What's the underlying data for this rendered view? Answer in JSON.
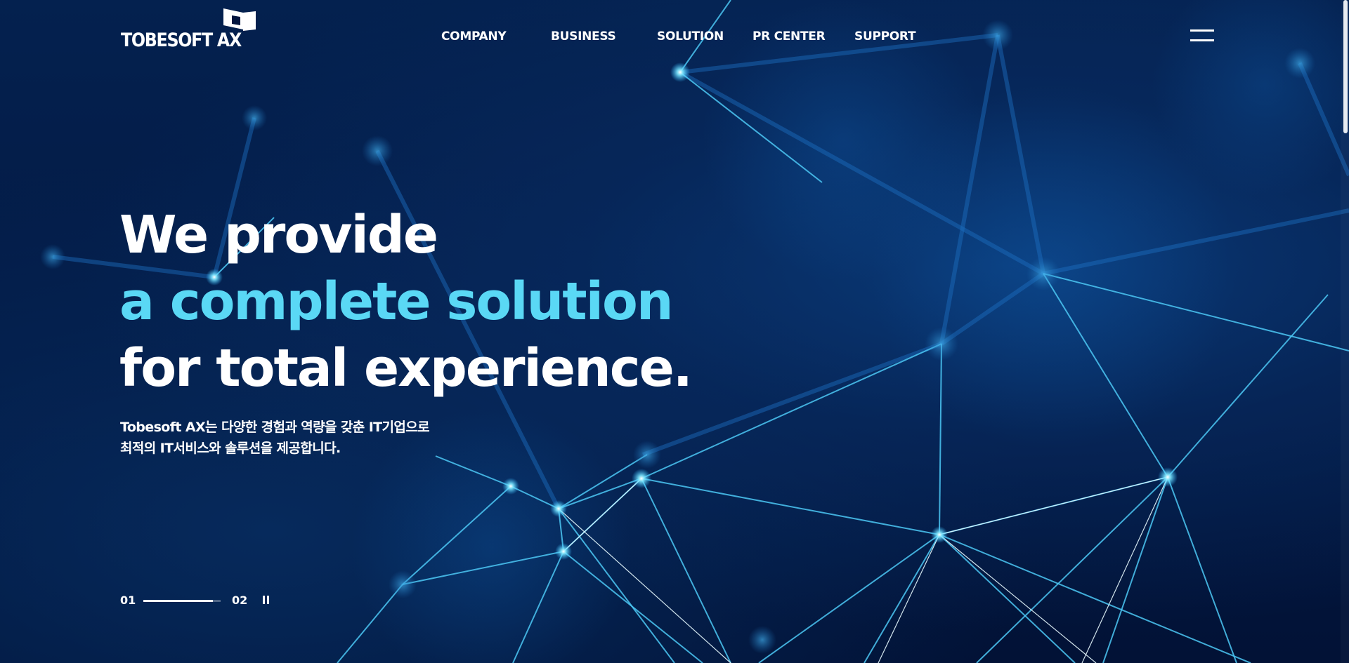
{
  "header": {
    "logo_text": "TOBESOFT AX",
    "nav": [
      {
        "label": "COMPANY"
      },
      {
        "label": "BUSINESS"
      },
      {
        "label": "SOLUTION"
      },
      {
        "label": "PR CENTER"
      },
      {
        "label": "SUPPORT"
      }
    ],
    "menu_icon": "hamburger-icon"
  },
  "hero": {
    "headline_line1": "We provide",
    "headline_line2": "a complete solution",
    "headline_line3": "for total experience.",
    "description_line1": "Tobesoft AX는 다양한 경험과 역량을 갖춘 IT기업으로",
    "description_line2": "최적의 IT서비스와 솔루션을 제공합니다.",
    "background": "network-nodes-image"
  },
  "slider": {
    "current": "01",
    "total": "02",
    "progress": 0.9,
    "pause_icon": "pause-icon"
  },
  "colors": {
    "accent": "#5ad8f5",
    "background": "#03163f",
    "text": "#ffffff"
  }
}
